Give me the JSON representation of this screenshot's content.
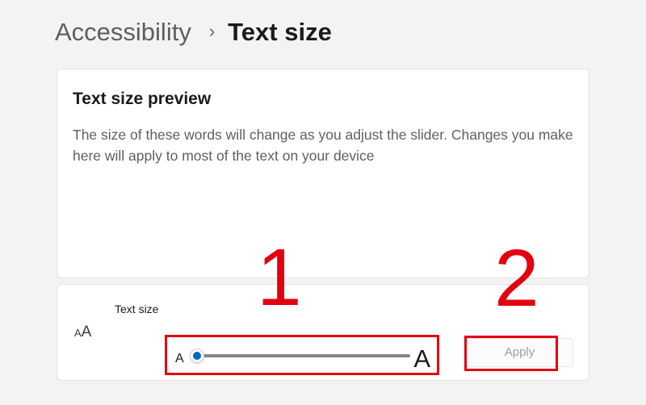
{
  "breadcrumb": {
    "parent": "Accessibility",
    "separator": "›",
    "current": "Text size"
  },
  "preview": {
    "title": "Text size preview",
    "description": "The size of these words will change as you adjust the slider. Changes you make here will apply to most of the text on your device"
  },
  "setting": {
    "icon": "text-size-icon",
    "icon_glyph_small": "A",
    "icon_glyph_large": "A",
    "label": "Text size",
    "slider": {
      "min_label": "A",
      "max_label": "A",
      "value_percent": 0
    },
    "apply_label": "Apply",
    "apply_enabled": false
  },
  "annotations": {
    "step_1": "1",
    "step_2": "2",
    "color": "#e3000f"
  },
  "colors": {
    "accent": "#0067c0",
    "background": "#f3f3f3",
    "card": "#ffffff"
  }
}
